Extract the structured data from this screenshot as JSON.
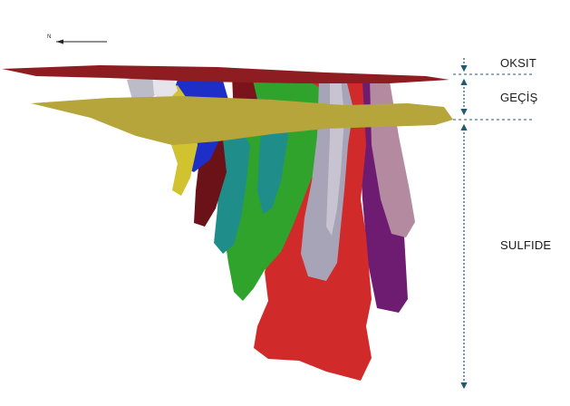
{
  "orientation": {
    "north_label": "N"
  },
  "zones": [
    {
      "id": "oxide",
      "label": "OKSIT"
    },
    {
      "id": "transition",
      "label": "GEÇİŞ"
    },
    {
      "id": "sulfide",
      "label": "SULFIDE"
    }
  ],
  "colors": {
    "oxide_layer": "#8e1d22",
    "transition_layer": "#b5a53a",
    "ore_red": "#d02a2a",
    "ore_green": "#2fa32c",
    "ore_blue": "#1d2fc8",
    "ore_purple": "#6e1c72",
    "ore_mauve": "#b38aa0",
    "ore_grey": "#a8a4b8",
    "ore_teal": "#1f8e8a",
    "ore_darkred": "#6a1218",
    "ore_yellow": "#d1c230",
    "annotation": "#1f5a72"
  }
}
